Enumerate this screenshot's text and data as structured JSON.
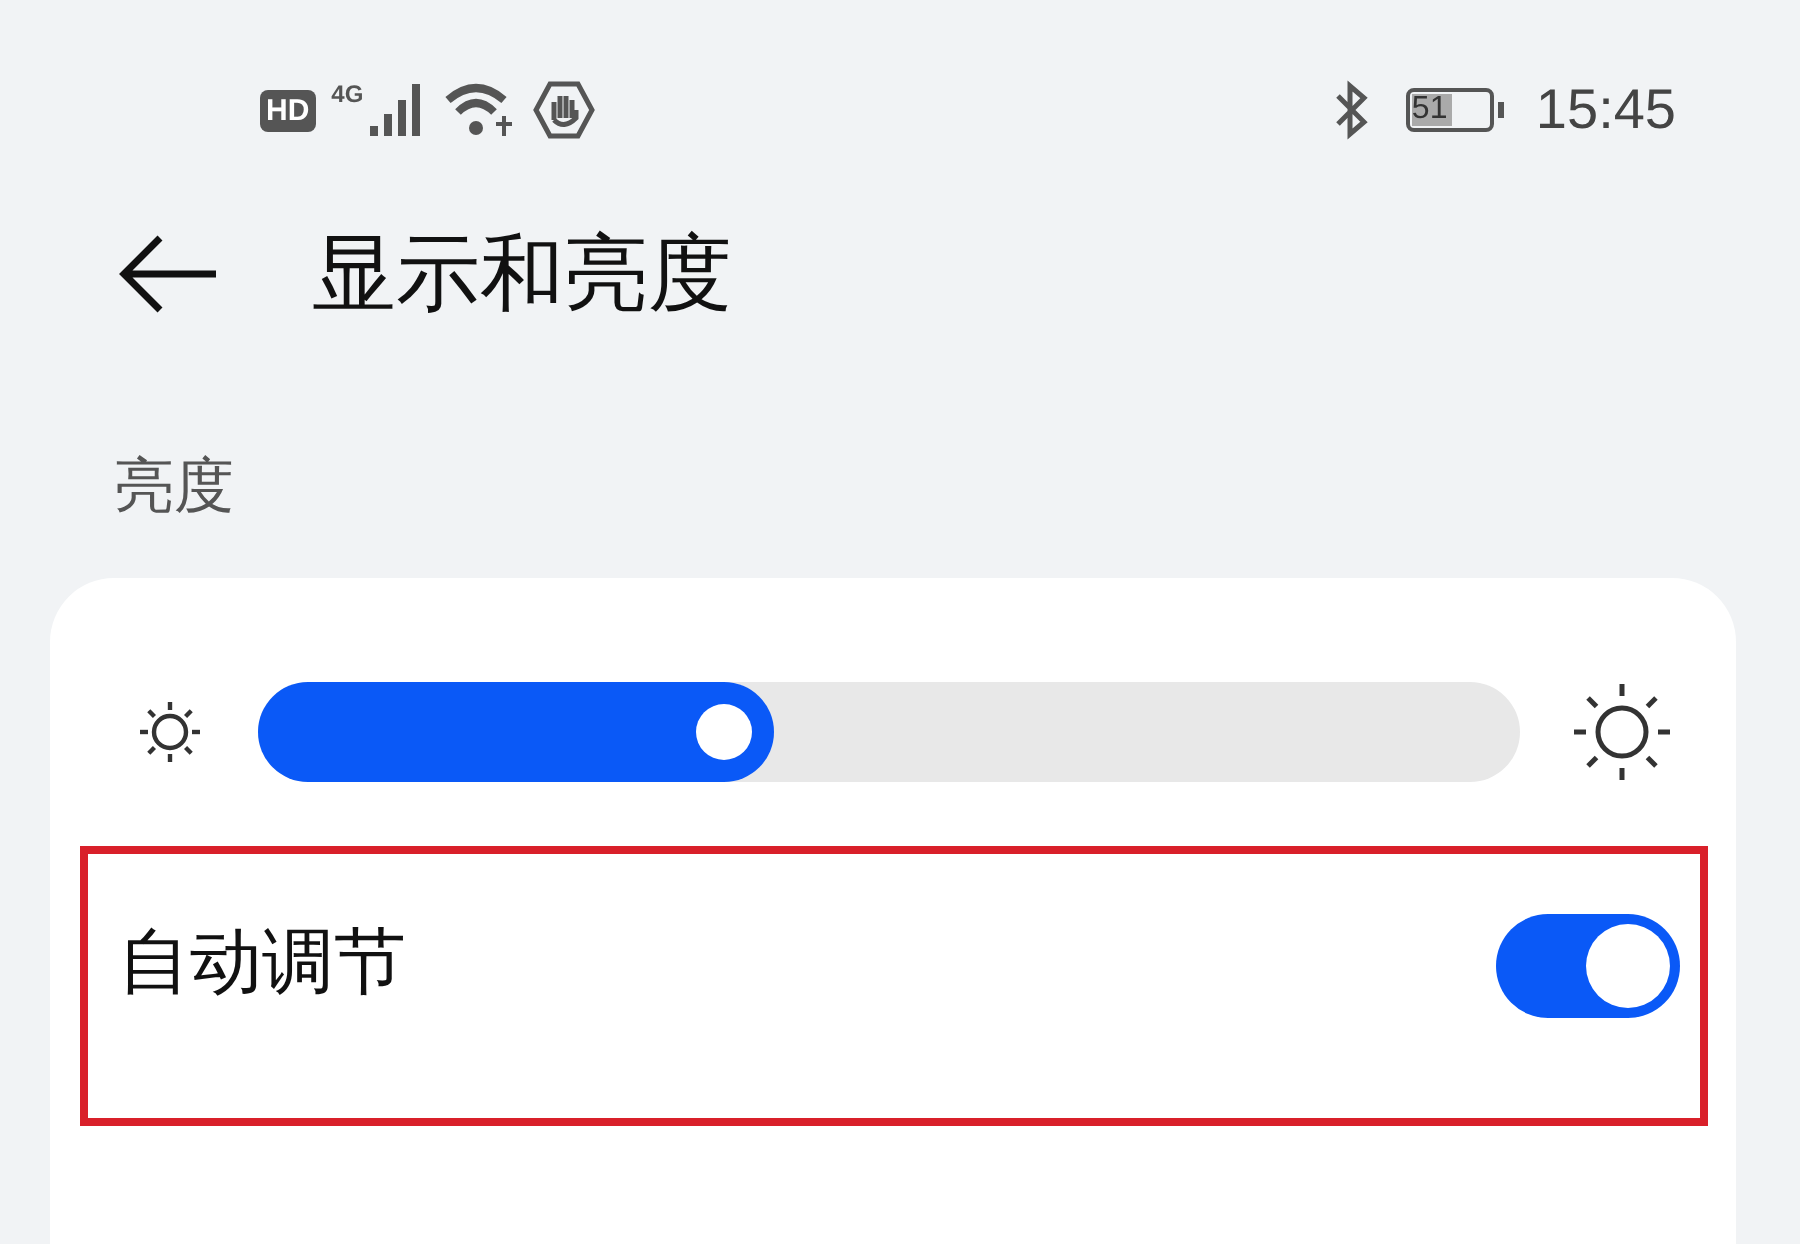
{
  "status_bar": {
    "hd_badge": "HD",
    "network": "4G",
    "battery": "51",
    "time": "15:45"
  },
  "header": {
    "title": "显示和亮度"
  },
  "section": {
    "label": "亮度"
  },
  "brightness": {
    "level": 0.37
  },
  "auto_adjust": {
    "label": "自动调节",
    "on": true,
    "highlighted": true
  }
}
